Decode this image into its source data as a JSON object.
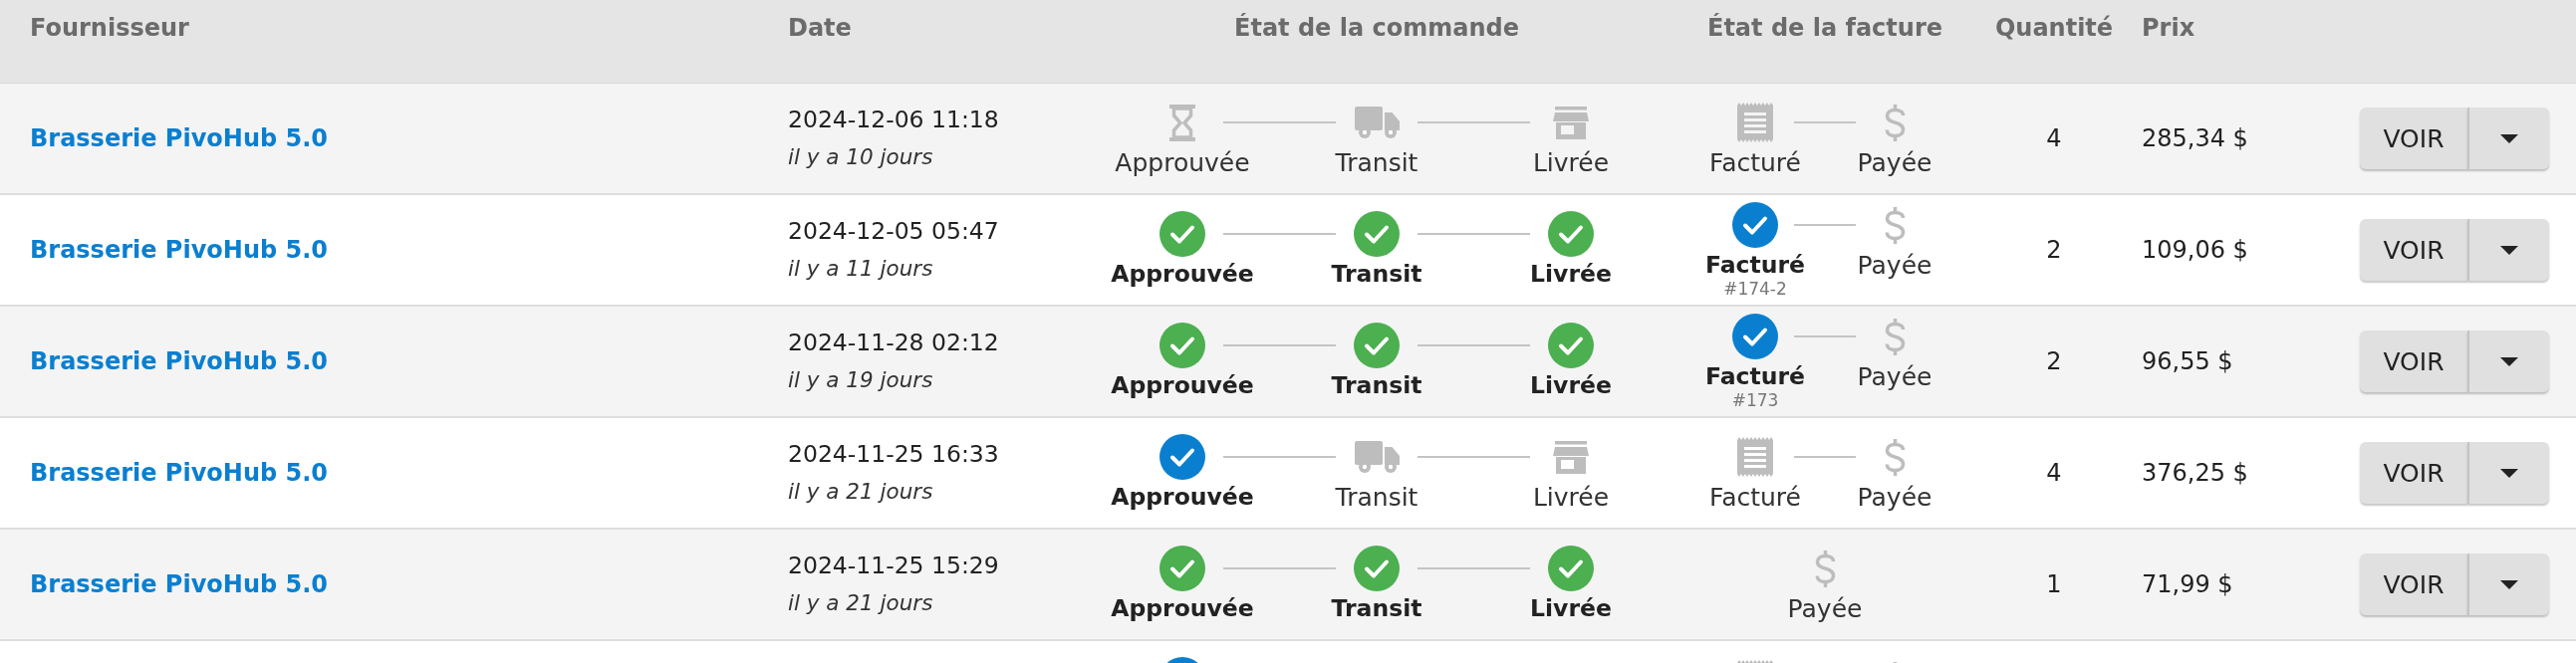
{
  "table": {
    "columns": [
      {
        "label": "Fournisseur"
      },
      {
        "label": "Date"
      },
      {
        "label": "État de la commande"
      },
      {
        "label": "État de la facture"
      },
      {
        "label": "Quantité"
      },
      {
        "label": "Prix"
      }
    ],
    "rows": [
      {
        "supplier": "Brasserie PivoHub 5.0",
        "date": "2024-12-06 11:18",
        "ago": "il y a 10 jours",
        "order_steps": [
          {
            "kind": "approved",
            "label": "Approuvée",
            "completed": false,
            "active": false
          },
          {
            "kind": "transit",
            "label": "Transit",
            "completed": false,
            "active": false
          },
          {
            "kind": "delivered",
            "label": "Livrée",
            "completed": false,
            "active": false
          }
        ],
        "invoice_steps": [
          {
            "kind": "invoiced",
            "label": "Facturé",
            "completed": false,
            "active": false
          },
          {
            "kind": "paid",
            "label": "Payée",
            "completed": false,
            "active": false
          }
        ],
        "quantity": "4",
        "price": "285,34 $",
        "action": "VOIR"
      },
      {
        "supplier": "Brasserie PivoHub 5.0",
        "date": "2024-12-05 05:47",
        "ago": "il y a 11 jours",
        "order_steps": [
          {
            "label": "Approuvée",
            "completed": true,
            "active": false
          },
          {
            "label": "Transit",
            "completed": true,
            "active": false
          },
          {
            "label": "Livrée",
            "completed": true,
            "active": false
          }
        ],
        "invoice_steps": [
          {
            "label": "Facturé",
            "completed": true,
            "active": true,
            "note": "#174-2"
          },
          {
            "kind": "paid",
            "label": "Payée",
            "completed": false,
            "active": false
          }
        ],
        "quantity": "2",
        "price": "109,06 $",
        "action": "VOIR"
      },
      {
        "supplier": "Brasserie PivoHub 5.0",
        "date": "2024-11-28 02:12",
        "ago": "il y a 19 jours",
        "order_steps": [
          {
            "label": "Approuvée",
            "completed": true,
            "active": false
          },
          {
            "label": "Transit",
            "completed": true,
            "active": false
          },
          {
            "label": "Livrée",
            "completed": true,
            "active": false
          }
        ],
        "invoice_steps": [
          {
            "label": "Facturé",
            "completed": true,
            "active": true,
            "note": "#173"
          },
          {
            "kind": "paid",
            "label": "Payée",
            "completed": false,
            "active": false
          }
        ],
        "quantity": "2",
        "price": "96,55 $",
        "action": "VOIR"
      },
      {
        "supplier": "Brasserie PivoHub 5.0",
        "date": "2024-11-25 16:33",
        "ago": "il y a 21 jours",
        "order_steps": [
          {
            "label": "Approuvée",
            "completed": true,
            "active": true
          },
          {
            "kind": "transit",
            "label": "Transit",
            "completed": false,
            "active": false
          },
          {
            "kind": "delivered",
            "label": "Livrée",
            "completed": false,
            "active": false
          }
        ],
        "invoice_steps": [
          {
            "kind": "invoiced",
            "label": "Facturé",
            "completed": false,
            "active": false
          },
          {
            "kind": "paid",
            "label": "Payée",
            "completed": false,
            "active": false
          }
        ],
        "quantity": "4",
        "price": "376,25 $",
        "action": "VOIR"
      },
      {
        "supplier": "Brasserie PivoHub 5.0",
        "date": "2024-11-25 15:29",
        "ago": "il y a 21 jours",
        "order_steps": [
          {
            "label": "Approuvée",
            "completed": true,
            "active": false
          },
          {
            "label": "Transit",
            "completed": true,
            "active": false
          },
          {
            "label": "Livrée",
            "completed": true,
            "active": false
          }
        ],
        "invoice_steps": [
          {
            "kind": "paid",
            "label": "Payée",
            "completed": false,
            "active": false
          }
        ],
        "quantity": "1",
        "price": "71,99 $",
        "action": "VOIR"
      },
      {
        "order_steps": [
          {
            "active": true
          }
        ],
        "invoice_steps": [
          {
            "kind": "invoiced",
            "completed": false,
            "active": false
          },
          {
            "kind": "paid",
            "completed": false,
            "active": false
          }
        ]
      }
    ]
  }
}
